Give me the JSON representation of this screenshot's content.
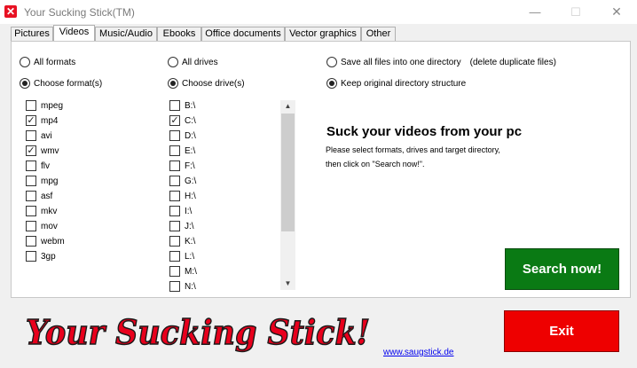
{
  "window": {
    "title": "Your Sucking Stick(TM)",
    "icon": "x-icon",
    "minimize_glyph": "—",
    "maximize_glyph": "☐",
    "close_glyph": "✕"
  },
  "tabs": [
    {
      "label": "Pictures",
      "active": false
    },
    {
      "label": "Videos",
      "active": true
    },
    {
      "label": "Music/Audio",
      "active": false
    },
    {
      "label": "Ebooks",
      "active": false
    },
    {
      "label": "Office documents",
      "active": false
    },
    {
      "label": "Vector graphics",
      "active": false
    },
    {
      "label": "Other",
      "active": false
    }
  ],
  "formats": {
    "all_label": "All formats",
    "all_selected": false,
    "choose_label": "Choose format(s)",
    "choose_selected": true,
    "items": [
      {
        "label": "mpeg",
        "checked": false
      },
      {
        "label": "mp4",
        "checked": true
      },
      {
        "label": "avi",
        "checked": false
      },
      {
        "label": "wmv",
        "checked": true
      },
      {
        "label": "flv",
        "checked": false
      },
      {
        "label": "mpg",
        "checked": false
      },
      {
        "label": "asf",
        "checked": false
      },
      {
        "label": "mkv",
        "checked": false
      },
      {
        "label": "mov",
        "checked": false
      },
      {
        "label": "webm",
        "checked": false
      },
      {
        "label": "3gp",
        "checked": false
      }
    ]
  },
  "drives": {
    "all_label": "All drives",
    "all_selected": false,
    "choose_label": "Choose drive(s)",
    "choose_selected": true,
    "items": [
      {
        "label": "B:\\",
        "checked": false
      },
      {
        "label": "C:\\",
        "checked": true
      },
      {
        "label": "D:\\",
        "checked": false
      },
      {
        "label": "E:\\",
        "checked": false
      },
      {
        "label": "F:\\",
        "checked": false
      },
      {
        "label": "G:\\",
        "checked": false
      },
      {
        "label": "H:\\",
        "checked": false
      },
      {
        "label": "I:\\",
        "checked": false
      },
      {
        "label": "J:\\",
        "checked": false
      },
      {
        "label": "K:\\",
        "checked": false
      },
      {
        "label": "L:\\",
        "checked": false
      },
      {
        "label": "M:\\",
        "checked": false
      },
      {
        "label": "N:\\",
        "checked": false
      }
    ]
  },
  "output": {
    "one_dir_label": "Save all files into one directory",
    "one_dir_note": "(delete duplicate files)",
    "one_dir_selected": false,
    "keep_label": "Keep original directory structure",
    "keep_selected": true
  },
  "info": {
    "heading": "Suck your videos from your pc",
    "line1": "Please select formats, drives and target directory,",
    "line2": "then click on \"Search now!\"."
  },
  "buttons": {
    "search": "Search now!",
    "exit": "Exit"
  },
  "logo_text": "Your Sucking Stick!",
  "link": "www.saugstick.de",
  "colors": {
    "search_bg": "#0a7a14",
    "exit_bg": "#ee0000",
    "logo_fill": "#e8001c"
  }
}
